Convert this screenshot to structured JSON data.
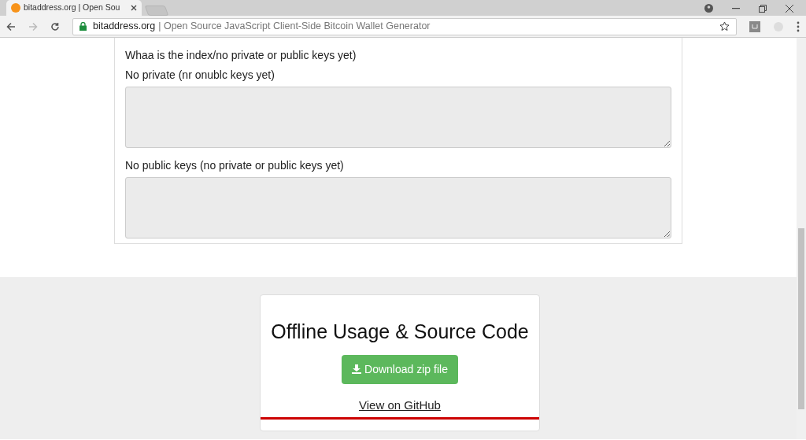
{
  "browser": {
    "tabs": [
      {
        "title": "bitaddress.org | Open Sou",
        "selected": true
      }
    ],
    "address": {
      "domain": "bitaddress.org",
      "title": "| Open Source JavaScript Client-Side Bitcoin Wallet Generator"
    }
  },
  "keys_panel": {
    "heading": "Whaa is the index/no private or public keys yet)",
    "fields": [
      {
        "label": "No private (nr onublc keys yet)"
      },
      {
        "label": "No public keys (no private or public keys yet)"
      }
    ]
  },
  "offline_card": {
    "title": "Offline Usage & Source Code",
    "download_button": "Download zip file",
    "link": "View on GitHub"
  }
}
